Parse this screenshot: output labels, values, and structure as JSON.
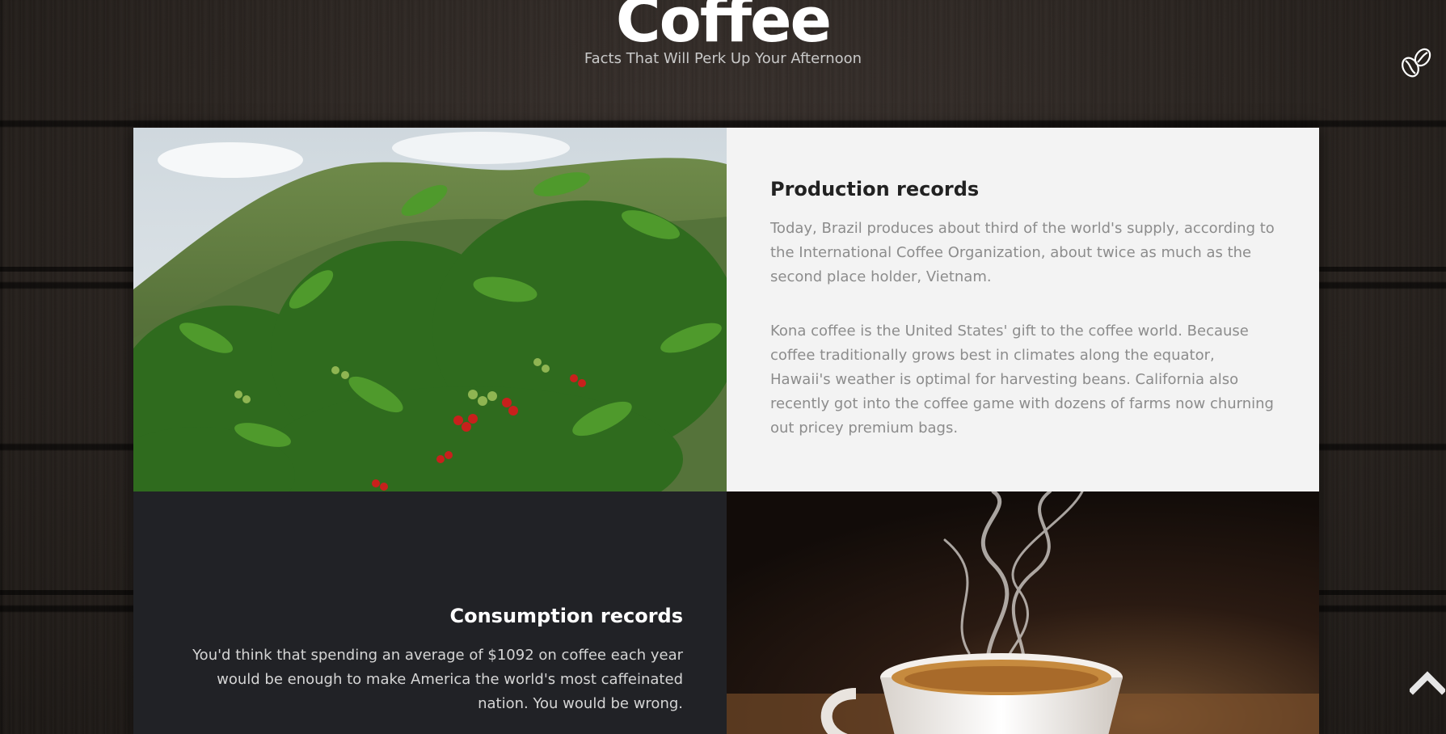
{
  "header": {
    "title": "Coffee",
    "subtitle": "Facts That Will Perk Up Your Afternoon"
  },
  "icons": {
    "top_right": "coffee-beans-icon",
    "bottom_right": "chevron-up-icon"
  },
  "sections": {
    "production": {
      "title": "Production records",
      "paragraphs": [
        "Today, Brazil produces about third of the world's supply, according to the International Coffee Organization, about twice as much as the second place holder, Vietnam.",
        "Kona coffee is the United States' gift to the coffee world. Because coffee traditionally grows best in climates along the equator, Hawaii's weather is optimal for harvesting beans. California also recently got into the coffee game with dozens of farms now churning out pricey premium bags."
      ]
    },
    "consumption": {
      "title": "Consumption records",
      "paragraphs": [
        "You'd think that spending an average of $1092 on coffee each year would be enough to make America the world's most caffeinated nation. You would be wrong."
      ]
    }
  },
  "colors": {
    "light_panel": "#f3f3f3",
    "dark_panel": "#212226",
    "heading_dark": "#222222",
    "body_gray": "#8c8c8c"
  }
}
